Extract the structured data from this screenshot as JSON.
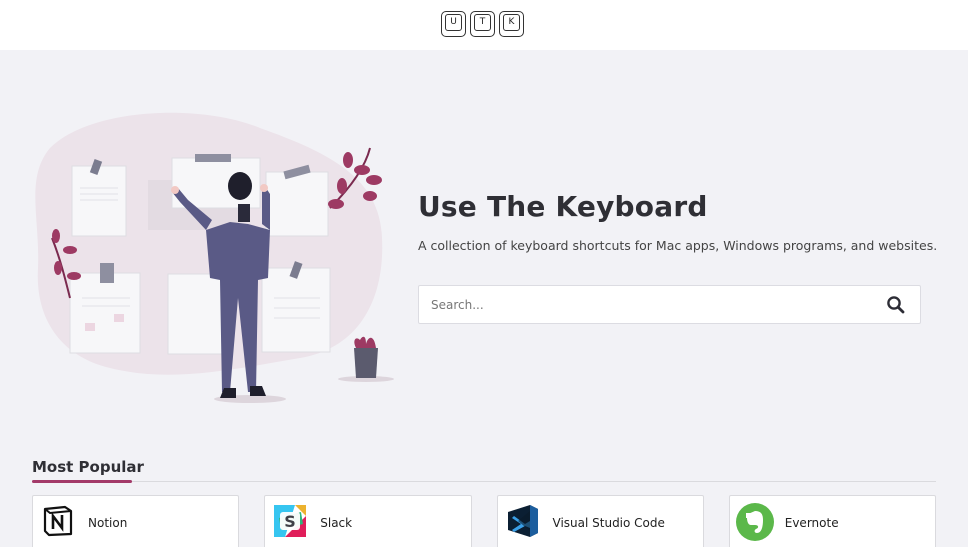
{
  "header": {
    "logo_keys": [
      "U",
      "T",
      "K"
    ]
  },
  "hero": {
    "title": "Use The Keyboard",
    "subtitle": "A collection of keyboard shortcuts for Mac apps, Windows programs, and websites."
  },
  "search": {
    "placeholder": "Search...",
    "value": ""
  },
  "popular": {
    "heading": "Most Popular",
    "apps": [
      {
        "name": "Notion",
        "icon": "notion-icon"
      },
      {
        "name": "Slack",
        "icon": "slack-icon"
      },
      {
        "name": "Visual Studio Code",
        "icon": "vscode-icon"
      },
      {
        "name": "Evernote",
        "icon": "evernote-icon"
      }
    ]
  },
  "colors": {
    "accent": "#a33a69",
    "background": "#f2f2f6",
    "header_bg": "#ffffff"
  }
}
